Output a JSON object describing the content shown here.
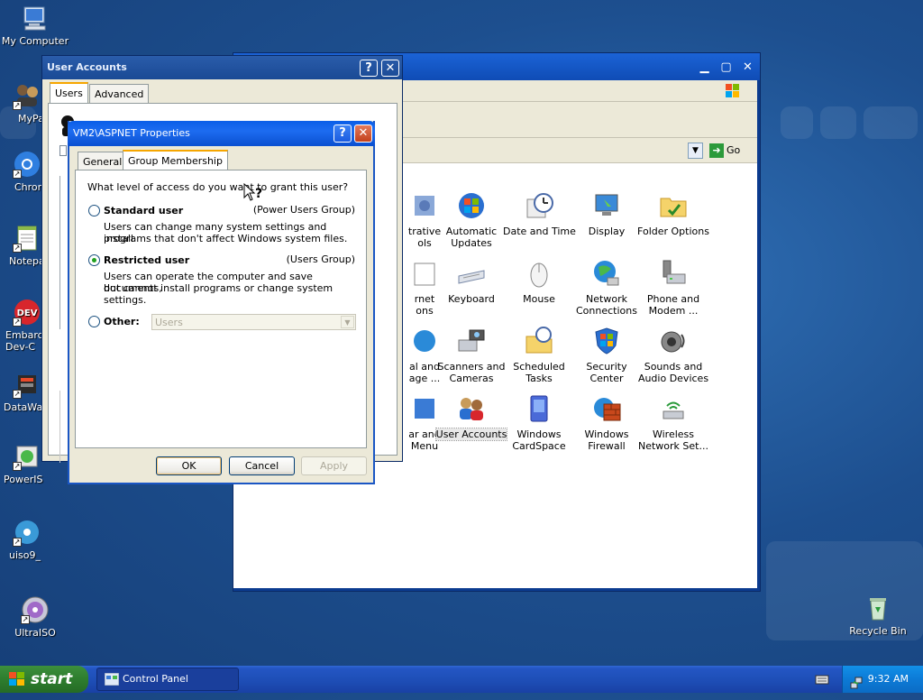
{
  "desktop": {
    "icons": [
      {
        "label": "My Computer"
      },
      {
        "label": "MyPa"
      },
      {
        "label": "Chrom"
      },
      {
        "label": "Notepa"
      },
      {
        "label": "Embarca\nDev-C"
      },
      {
        "label": "DataWa"
      },
      {
        "label": "PowerIS"
      },
      {
        "label": "uiso9_"
      },
      {
        "label": "UltraISO"
      },
      {
        "label": "Recycle Bin"
      }
    ]
  },
  "control_panel": {
    "go_label": "Go",
    "items": [
      {
        "label": "trative\nols"
      },
      {
        "label": "Automatic\nUpdates"
      },
      {
        "label": "Date and Time"
      },
      {
        "label": "Display"
      },
      {
        "label": "Folder Options"
      },
      {
        "label": "rnet\nons"
      },
      {
        "label": "Keyboard"
      },
      {
        "label": "Mouse"
      },
      {
        "label": "Network\nConnections"
      },
      {
        "label": "Phone and\nModem ..."
      },
      {
        "label": "al and\nage ..."
      },
      {
        "label": "Scanners and\nCameras"
      },
      {
        "label": "Scheduled\nTasks"
      },
      {
        "label": "Security\nCenter"
      },
      {
        "label": "Sounds and\nAudio Devices"
      },
      {
        "label": "ar and\nMenu"
      },
      {
        "label": "User Accounts"
      },
      {
        "label": "Windows\nCardSpace"
      },
      {
        "label": "Windows\nFirewall"
      },
      {
        "label": "Wireless\nNetwork Set..."
      }
    ]
  },
  "user_accounts": {
    "title": "User Accounts",
    "tabs": {
      "users": "Users",
      "advanced": "Advanced"
    }
  },
  "properties": {
    "title": "VM2\\ASPNET Properties",
    "tabs": {
      "general": "General",
      "group_membership": "Group Membership"
    },
    "question": "What level of access do you want to grant this user?",
    "standard": {
      "label": "Standard user",
      "group": "(Power Users Group)",
      "desc1": "Users can change many system settings and install",
      "desc2": "programs that don't affect Windows system files."
    },
    "restricted": {
      "label": "Restricted user",
      "group": "(Users Group)",
      "desc1": "Users can operate the computer and save documents,",
      "desc2": "but cannot install programs or change system settings."
    },
    "other": {
      "label": "Other:",
      "value": "Users"
    },
    "selected": "restricted",
    "buttons": {
      "ok": "OK",
      "cancel": "Cancel",
      "apply": "Apply"
    }
  },
  "taskbar": {
    "start_label": "start",
    "task_label": "Control Panel",
    "clock": "9:32 AM"
  }
}
